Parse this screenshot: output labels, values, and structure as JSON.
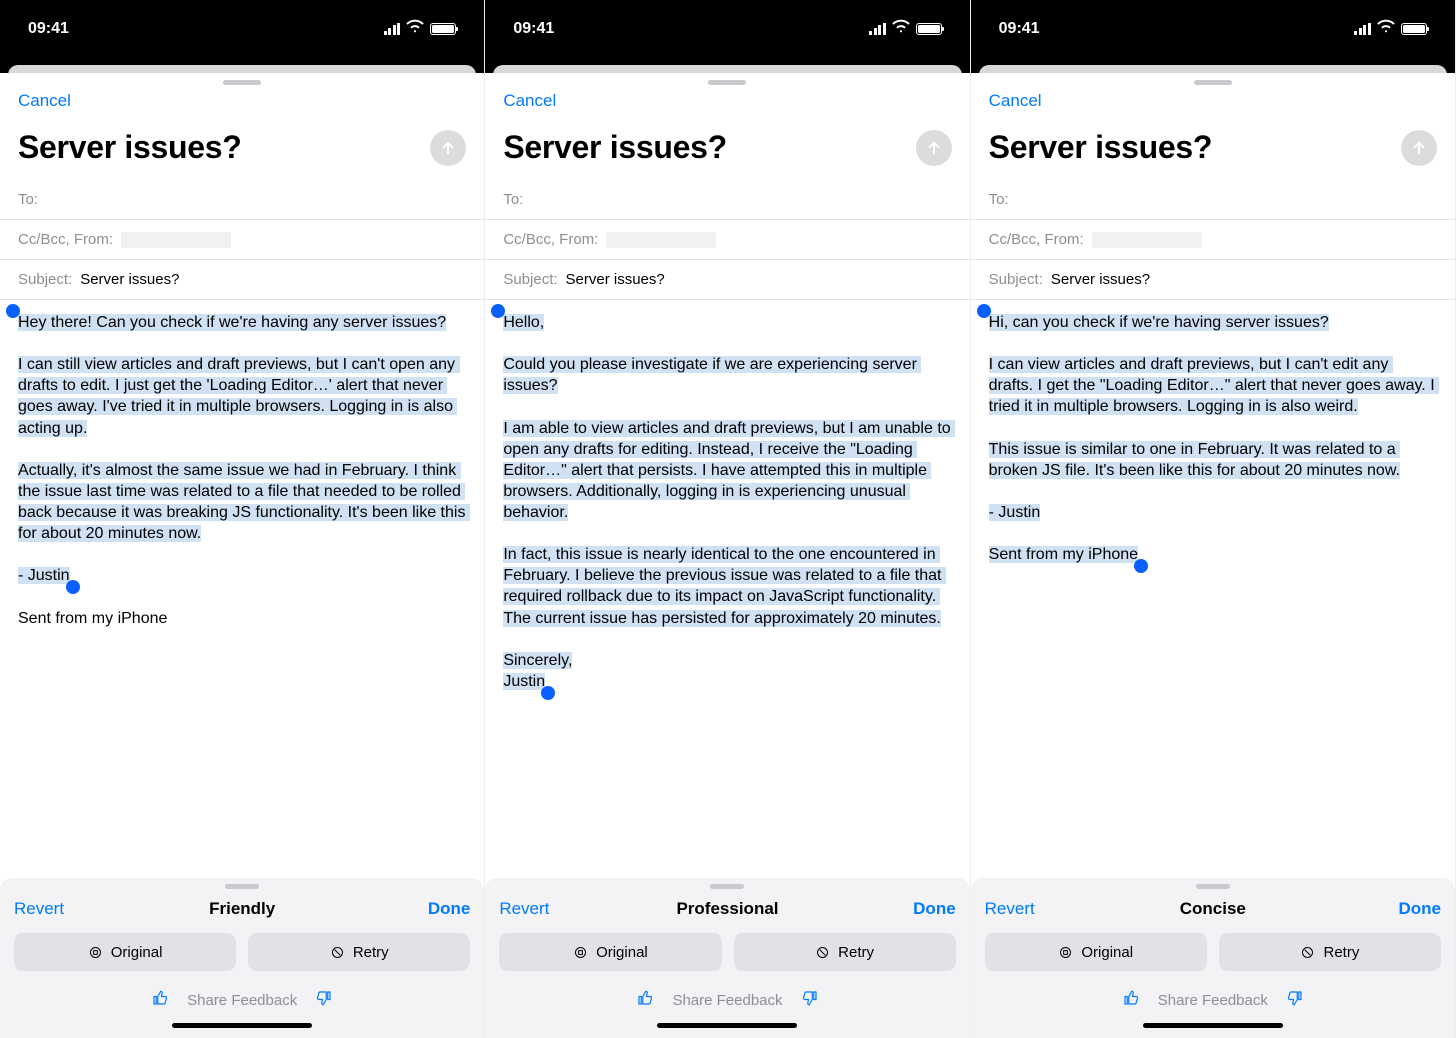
{
  "status": {
    "time": "09:41"
  },
  "compose": {
    "cancel": "Cancel",
    "title": "Server issues?",
    "to_label": "To:",
    "ccbcc_label": "Cc/Bcc, From:",
    "subject_label": "Subject:",
    "subject_value": "Server issues?",
    "signature": "Sent from my iPhone"
  },
  "panel": {
    "revert": "Revert",
    "done": "Done",
    "original": "Original",
    "retry": "Retry",
    "feedback": "Share Feedback"
  },
  "screens": [
    {
      "tone": "Friendly",
      "body": "Hey there! Can you check if we're having any server issues?\n\nI can still view articles and draft previews, but I can't open any drafts to edit. I just get the 'Loading Editor…' alert that never goes away. I've tried it in multiple browsers. Logging in is also acting up.\n\nActually, it's almost the same issue we had in February. I think the issue last time was related to a file that needed to be rolled back because it was breaking JS functionality. It's been like this for about 20 minutes now.\n\n- Justin",
      "signature_in_sel": false
    },
    {
      "tone": "Professional",
      "body": "Hello,\n\nCould you please investigate if we are experiencing server issues?\n\nI am able to view articles and draft previews, but I am unable to open any drafts for editing. Instead, I receive the \"Loading Editor…\" alert that persists. I have attempted this in multiple browsers. Additionally, logging in is experiencing unusual behavior.\n\nIn fact, this issue is nearly identical to the one encountered in February. I believe the previous issue was related to a file that required rollback due to its impact on JavaScript functionality. The current issue has persisted for approximately 20 minutes.\n\nSincerely,\nJustin",
      "signature_in_sel": false,
      "hide_signature": true
    },
    {
      "tone": "Concise",
      "body": "Hi, can you check if we're having server issues?\n\nI can view articles and draft previews, but I can't edit any drafts. I get the \"Loading Editor…\" alert that never goes away. I tried it in multiple browsers. Logging in is also weird.\n\nThis issue is similar to one in February. It was related to a broken JS file. It's been like this for about 20 minutes now.\n\n- Justin\n\nSent from my iPhone",
      "signature_in_sel": true
    }
  ]
}
